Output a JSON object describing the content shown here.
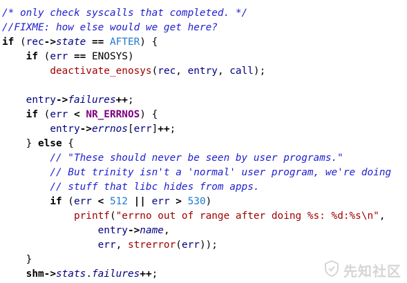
{
  "code": {
    "lines": [
      [
        {
          "cls": "comment",
          "text": "/* only check syscalls that completed. */"
        }
      ],
      [
        {
          "cls": "comment",
          "text": "//FIXME: how else would we get here?"
        }
      ],
      [
        {
          "cls": "kw",
          "text": "if"
        },
        {
          "cls": "punct",
          "text": " ("
        },
        {
          "cls": "ident",
          "text": "rec"
        },
        {
          "cls": "op",
          "text": "->"
        },
        {
          "cls": "member",
          "text": "state"
        },
        {
          "cls": "op",
          "text": " == "
        },
        {
          "cls": "macro",
          "text": "AFTER"
        },
        {
          "cls": "punct",
          "text": ") {"
        }
      ],
      [
        {
          "cls": "punct",
          "text": "    "
        },
        {
          "cls": "kw",
          "text": "if"
        },
        {
          "cls": "punct",
          "text": " ("
        },
        {
          "cls": "ident",
          "text": "err"
        },
        {
          "cls": "op",
          "text": " == "
        },
        {
          "cls": "punct",
          "text": "ENOSYS)"
        }
      ],
      [
        {
          "cls": "punct",
          "text": "        "
        },
        {
          "cls": "fn",
          "text": "deactivate_enosys"
        },
        {
          "cls": "punct",
          "text": "("
        },
        {
          "cls": "ident",
          "text": "rec"
        },
        {
          "cls": "punct",
          "text": ", "
        },
        {
          "cls": "ident",
          "text": "entry"
        },
        {
          "cls": "punct",
          "text": ", "
        },
        {
          "cls": "ident",
          "text": "call"
        },
        {
          "cls": "punct",
          "text": ");"
        }
      ],
      [
        {
          "cls": "punct",
          "text": ""
        }
      ],
      [
        {
          "cls": "punct",
          "text": "    "
        },
        {
          "cls": "ident",
          "text": "entry"
        },
        {
          "cls": "op",
          "text": "->"
        },
        {
          "cls": "member",
          "text": "failures"
        },
        {
          "cls": "op",
          "text": "++"
        },
        {
          "cls": "punct",
          "text": ";"
        }
      ],
      [
        {
          "cls": "punct",
          "text": "    "
        },
        {
          "cls": "kw",
          "text": "if"
        },
        {
          "cls": "punct",
          "text": " ("
        },
        {
          "cls": "ident",
          "text": "err"
        },
        {
          "cls": "op",
          "text": " < "
        },
        {
          "cls": "macro-bold",
          "text": "NR_ERRNOS"
        },
        {
          "cls": "punct",
          "text": ") {"
        }
      ],
      [
        {
          "cls": "punct",
          "text": "        "
        },
        {
          "cls": "ident",
          "text": "entry"
        },
        {
          "cls": "op",
          "text": "->"
        },
        {
          "cls": "member",
          "text": "errnos"
        },
        {
          "cls": "punct",
          "text": "["
        },
        {
          "cls": "ident",
          "text": "err"
        },
        {
          "cls": "punct",
          "text": "]"
        },
        {
          "cls": "op",
          "text": "++"
        },
        {
          "cls": "punct",
          "text": ";"
        }
      ],
      [
        {
          "cls": "punct",
          "text": "    } "
        },
        {
          "cls": "kw",
          "text": "else"
        },
        {
          "cls": "punct",
          "text": " {"
        }
      ],
      [
        {
          "cls": "punct",
          "text": "        "
        },
        {
          "cls": "comment",
          "text": "// \"These should never be seen by user programs.\""
        }
      ],
      [
        {
          "cls": "punct",
          "text": "        "
        },
        {
          "cls": "comment",
          "text": "// But trinity isn't a 'normal' user program, we're doing"
        }
      ],
      [
        {
          "cls": "punct",
          "text": "        "
        },
        {
          "cls": "comment",
          "text": "// stuff that libc hides from apps."
        }
      ],
      [
        {
          "cls": "punct",
          "text": "        "
        },
        {
          "cls": "kw",
          "text": "if"
        },
        {
          "cls": "punct",
          "text": " ("
        },
        {
          "cls": "ident",
          "text": "err"
        },
        {
          "cls": "op",
          "text": " < "
        },
        {
          "cls": "num",
          "text": "512"
        },
        {
          "cls": "op",
          "text": " || "
        },
        {
          "cls": "ident",
          "text": "err"
        },
        {
          "cls": "op",
          "text": " > "
        },
        {
          "cls": "num",
          "text": "530"
        },
        {
          "cls": "punct",
          "text": ")"
        }
      ],
      [
        {
          "cls": "punct",
          "text": "            "
        },
        {
          "cls": "fn",
          "text": "printf"
        },
        {
          "cls": "punct",
          "text": "("
        },
        {
          "cls": "str",
          "text": "\"errno out of range after doing %s: %d:%s\\n\""
        },
        {
          "cls": "punct",
          "text": ","
        }
      ],
      [
        {
          "cls": "punct",
          "text": "                "
        },
        {
          "cls": "ident",
          "text": "entry"
        },
        {
          "cls": "op",
          "text": "->"
        },
        {
          "cls": "member",
          "text": "name"
        },
        {
          "cls": "punct",
          "text": ","
        }
      ],
      [
        {
          "cls": "punct",
          "text": "                "
        },
        {
          "cls": "ident",
          "text": "err"
        },
        {
          "cls": "punct",
          "text": ", "
        },
        {
          "cls": "fn",
          "text": "strerror"
        },
        {
          "cls": "punct",
          "text": "("
        },
        {
          "cls": "ident",
          "text": "err"
        },
        {
          "cls": "punct",
          "text": "));"
        }
      ],
      [
        {
          "cls": "punct",
          "text": "    }"
        }
      ],
      [
        {
          "cls": "punct",
          "text": "    "
        },
        {
          "cls": "kw",
          "text": "shm"
        },
        {
          "cls": "op",
          "text": "->"
        },
        {
          "cls": "member",
          "text": "stats"
        },
        {
          "cls": "punct",
          "text": "."
        },
        {
          "cls": "member",
          "text": "failures"
        },
        {
          "cls": "op",
          "text": "++"
        },
        {
          "cls": "punct",
          "text": ";"
        }
      ]
    ]
  },
  "watermark": {
    "icon": "shield-icon",
    "text": "先知社区",
    "color": "#888888"
  },
  "colors": {
    "background": "#ffffff",
    "comment": "#2020d0",
    "member": "#000080",
    "macro": "#1e78d0",
    "macro_bold": "#800080",
    "function": "#a00000",
    "string": "#a00000",
    "number": "#1e78d0"
  }
}
